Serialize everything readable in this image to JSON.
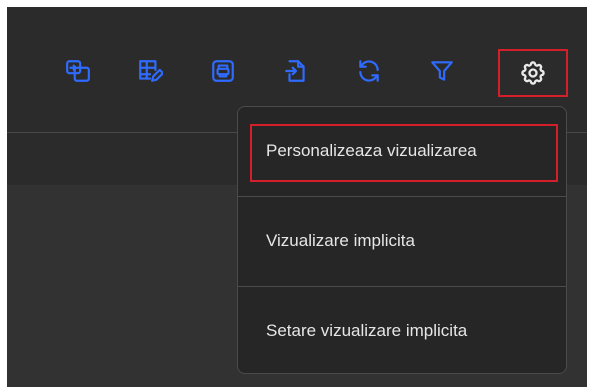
{
  "toolbar": {
    "accent_color": "#2f6bff",
    "active_outline_color": "#d21f2a",
    "icons": [
      {
        "name": "swap-view-icon"
      },
      {
        "name": "edit-table-icon"
      },
      {
        "name": "print-icon"
      },
      {
        "name": "export-icon"
      },
      {
        "name": "refresh-icon"
      },
      {
        "name": "filter-icon"
      },
      {
        "name": "settings-gear-icon",
        "active": true
      }
    ]
  },
  "settings_menu": {
    "items": [
      {
        "label": "Personalizeaza vizualizarea",
        "highlighted": true
      },
      {
        "label": "Vizualizare implicita"
      },
      {
        "label": "Setare vizualizare implicita"
      }
    ]
  }
}
